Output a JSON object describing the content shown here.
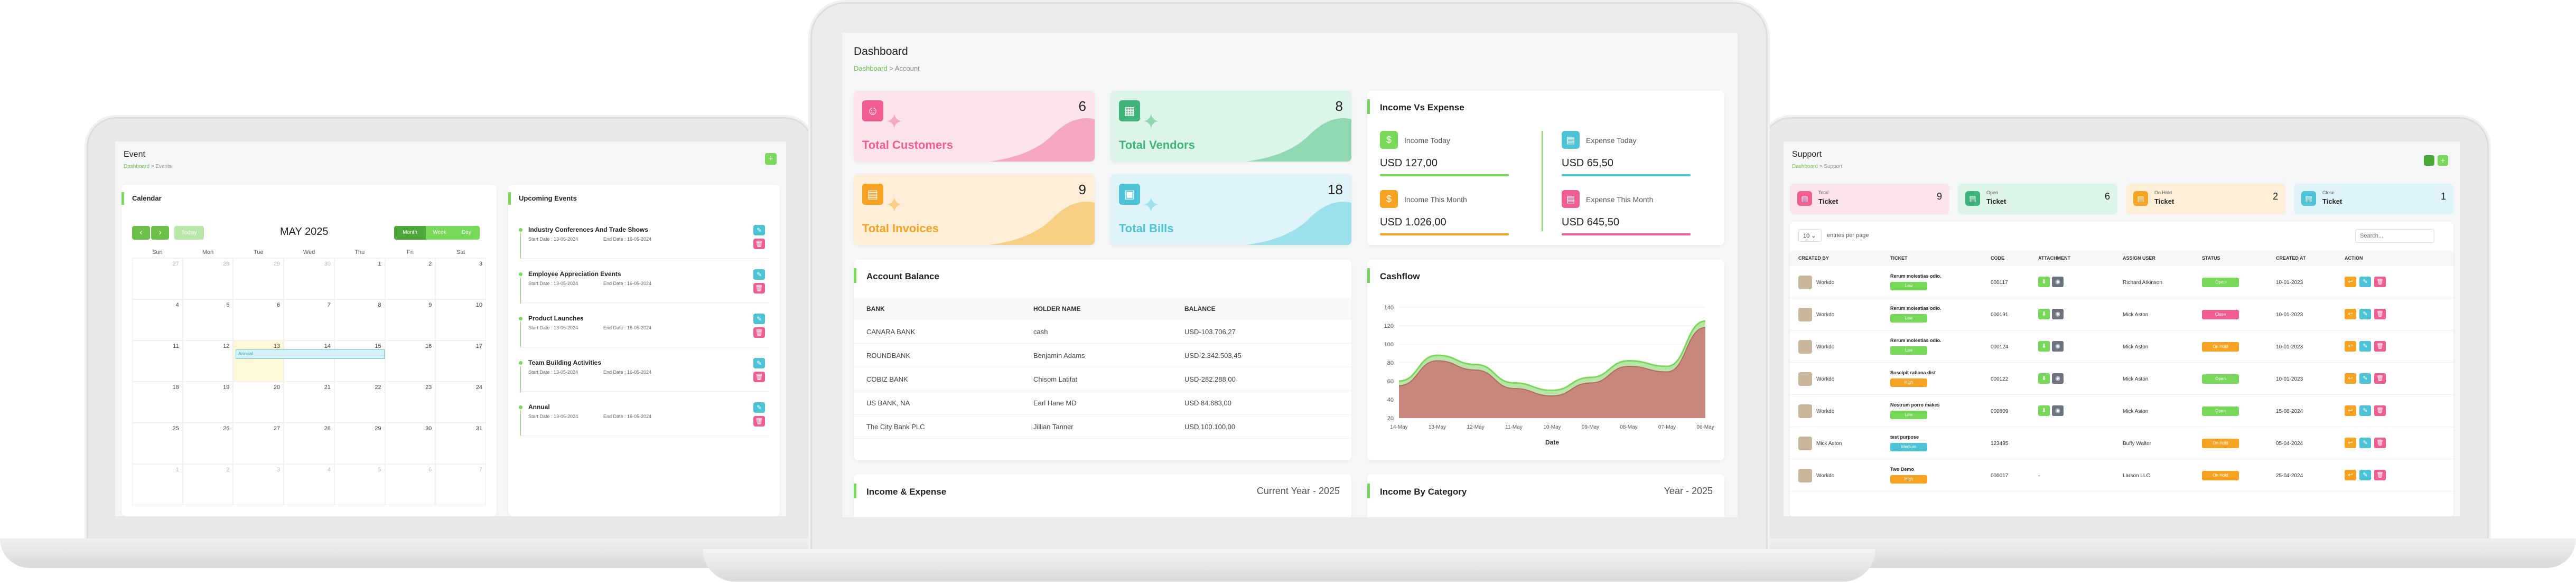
{
  "colors": {
    "accent": "#78d85a",
    "pink": "#ef5d92",
    "orange": "#f6a223",
    "blue": "#4ec3d6",
    "green": "#5cc47a"
  },
  "event": {
    "title": "Event",
    "crumb_home": "Dashboard",
    "crumb_sep": ">",
    "crumb_current": "Events",
    "add": "+",
    "calendar_title": "Calendar",
    "month": "MAY 2025",
    "prev": "‹",
    "next": "›",
    "today": "Today",
    "views": [
      "Month",
      "Week",
      "Day"
    ],
    "weekdays": [
      "Sun",
      "Mon",
      "Tue",
      "Wed",
      "Thu",
      "Fri",
      "Sat"
    ],
    "weeks": [
      [
        "27",
        "28",
        "29",
        "30",
        "1",
        "2",
        "3"
      ],
      [
        "4",
        "5",
        "6",
        "7",
        "8",
        "9",
        "10"
      ],
      [
        "11",
        "12",
        "13",
        "14",
        "15",
        "16",
        "17"
      ],
      [
        "18",
        "19",
        "20",
        "21",
        "22",
        "23",
        "24"
      ],
      [
        "25",
        "26",
        "27",
        "28",
        "29",
        "30",
        "31"
      ],
      [
        "1",
        "2",
        "3",
        "4",
        "5",
        "6",
        "7"
      ]
    ],
    "cal_event": "Annual",
    "upcoming_title": "Upcoming Events",
    "upcoming": [
      {
        "name": "Industry Conferences And Trade Shows",
        "start": "Start Date : 13-05-2024",
        "end": "End Date : 16-05-2024"
      },
      {
        "name": "Employee Appreciation Events",
        "start": "Start Date : 13-05-2024",
        "end": "End Date : 16-05-2024"
      },
      {
        "name": "Product Launches",
        "start": "Start Date : 13-05-2024",
        "end": "End Date : 16-05-2024"
      },
      {
        "name": "Team Building Activities",
        "start": "Start Date : 13-05-2024",
        "end": "End Date : 16-05-2024"
      },
      {
        "name": "Annual",
        "start": "Start Date : 13-05-2024",
        "end": "End Date : 16-05-2024"
      }
    ]
  },
  "dash": {
    "title": "Dashboard",
    "crumb_home": "Dashboard",
    "crumb_sep": ">",
    "crumb_current": "Account",
    "stats": [
      {
        "label": "Total Customers",
        "value": "6"
      },
      {
        "label": "Total Vendors",
        "value": "8"
      },
      {
        "label": "Total Invoices",
        "value": "9"
      },
      {
        "label": "Total Bills",
        "value": "18"
      }
    ],
    "ive_title": "Income Vs Expense",
    "ive": [
      {
        "label": "Income Today",
        "value": "USD 127,00"
      },
      {
        "label": "Expense Today",
        "value": "USD 65,50"
      },
      {
        "label": "Income This Month",
        "value": "USD 1.026,00"
      },
      {
        "label": "Expense This Month",
        "value": "USD 645,50"
      }
    ],
    "balance_title": "Account Balance",
    "balance_cols": [
      "BANK",
      "HOLDER NAME",
      "BALANCE"
    ],
    "balance_rows": [
      [
        "CANARA BANK",
        "cash",
        "USD-103.706,27"
      ],
      [
        "ROUNDBANK",
        "Benjamin Adams",
        "USD-2.342.503,45"
      ],
      [
        "COBIZ BANK",
        "Chisom Latifat",
        "USD-282.288,00"
      ],
      [
        "US BANK, NA",
        "Earl Hane MD",
        "USD 84.683,00"
      ],
      [
        "The City Bank PLC",
        "Jillian Tanner",
        "USD 100.100,00"
      ]
    ],
    "cashflow_title": "Cashflow",
    "ie_title": "Income & Expense",
    "ie_period": "Current Year - 2025",
    "cat_title": "Income By Category",
    "cat_period": "Year - 2025"
  },
  "chart_data": {
    "type": "area",
    "title": "Cashflow",
    "xlabel": "Date",
    "ylabel": "",
    "x": [
      "14-May",
      "13-May",
      "12-May",
      "11-May",
      "10-May",
      "09-May",
      "08-May",
      "07-May",
      "06-May"
    ],
    "ylim": [
      20,
      140
    ],
    "yticks": [
      "140",
      "120",
      "100",
      "80",
      "60",
      "40",
      "20"
    ],
    "series": [
      {
        "values": [
          60,
          88,
          78,
          58,
          50,
          64,
          82,
          76,
          125
        ]
      },
      {
        "values": [
          55,
          82,
          72,
          52,
          44,
          58,
          76,
          70,
          118
        ]
      }
    ]
  },
  "support": {
    "title": "Support",
    "crumb_home": "Dashboard",
    "crumb_sep": ">",
    "crumb_current": "Support",
    "stats": [
      {
        "label": "Total",
        "sub": "Ticket",
        "value": "9"
      },
      {
        "label": "Open",
        "sub": "Ticket",
        "value": "6"
      },
      {
        "label": "On Hold",
        "sub": "Ticket",
        "value": "2"
      },
      {
        "label": "Close",
        "sub": "Ticket",
        "value": "1"
      }
    ],
    "per_page": "10",
    "per_page_label": "entries per page",
    "search_placeholder": "Search...",
    "cols": [
      "CREATED BY",
      "TICKET",
      "CODE",
      "ATTACHMENT",
      "ASSIGN USER",
      "STATUS",
      "CREATED AT",
      "ACTION"
    ],
    "rows": [
      {
        "by": "Workdo",
        "ticket": "Rerum molestias odio.",
        "pri": "Low",
        "code": "000117",
        "user": "Richard Atkinson",
        "status": "Open",
        "date": "10-01-2023"
      },
      {
        "by": "Workdo",
        "ticket": "Rerum molestias odio.",
        "pri": "Low",
        "code": "000191",
        "user": "Mick Aston",
        "status": "Close",
        "date": "10-01-2023"
      },
      {
        "by": "Workdo",
        "ticket": "Rerum molestias odio.",
        "pri": "Low",
        "code": "000124",
        "user": "Mick Aston",
        "status": "On Hold",
        "date": "10-01-2023"
      },
      {
        "by": "Workdo",
        "ticket": "Suscipit rationa dist",
        "pri": "High",
        "code": "000122",
        "user": "Mick Aston",
        "status": "Open",
        "date": "10-01-2023"
      },
      {
        "by": "Workdo",
        "ticket": "Nostrum porro makes",
        "pri": "Low",
        "code": "000809",
        "user": "Mick Aston",
        "status": "Open",
        "date": "15-08-2024"
      },
      {
        "by": "Mick Aston",
        "ticket": "test purpose",
        "pri": "Medium",
        "code": "123495",
        "user": "Buffy Walter",
        "status": "On Hold",
        "date": "05-04-2024"
      },
      {
        "by": "Workdo",
        "ticket": "Two Demo",
        "pri": "High",
        "code": "000017",
        "user": "Larson LLC",
        "status": "On Hold",
        "date": "25-04-2024"
      }
    ]
  }
}
